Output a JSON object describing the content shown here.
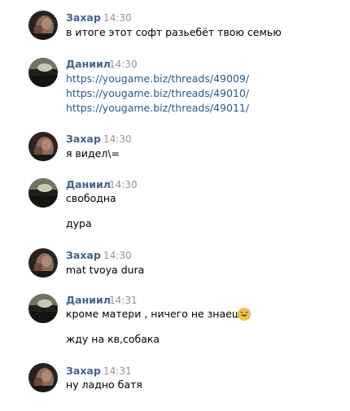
{
  "messages": [
    {
      "author": "Захар",
      "time": "14:30",
      "avatar_icon": "avatar-zahar-icon",
      "lines": [
        "в итоге этот софт разьебёт твою семью"
      ]
    },
    {
      "author": "Даниил",
      "time": "14:30",
      "avatar_icon": "avatar-daniil-icon",
      "links": [
        "https://yougame.biz/threads/49009/",
        "https://yougame.biz/threads/49010/",
        "https://yougame.biz/threads/49011/"
      ]
    },
    {
      "author": "Захар",
      "time": "14:30",
      "avatar_icon": "avatar-zahar-icon",
      "lines": [
        "я видел\\="
      ]
    },
    {
      "author": "Даниил",
      "time": "14:30",
      "avatar_icon": "avatar-daniil-icon",
      "lines": [
        "свободна",
        "дура"
      ]
    },
    {
      "author": "Захар",
      "time": "14:30",
      "avatar_icon": "avatar-zahar-icon",
      "lines": [
        "mat tvoya dura"
      ]
    },
    {
      "author": "Даниил",
      "time": "14:31",
      "avatar_icon": "avatar-daniil-icon",
      "lines": [
        "кроме матери , ничего не знаешь)",
        "жду на кв,собака"
      ],
      "emoji": "sweat-smile-emoji-icon"
    },
    {
      "author": "Захар",
      "time": "14:31",
      "avatar_icon": "avatar-zahar-icon",
      "lines": [
        "ну ладно батя"
      ]
    }
  ],
  "colors": {
    "author_name": "#42648b",
    "timestamp": "#939393",
    "text": "#000000",
    "link": "#2a5885"
  }
}
